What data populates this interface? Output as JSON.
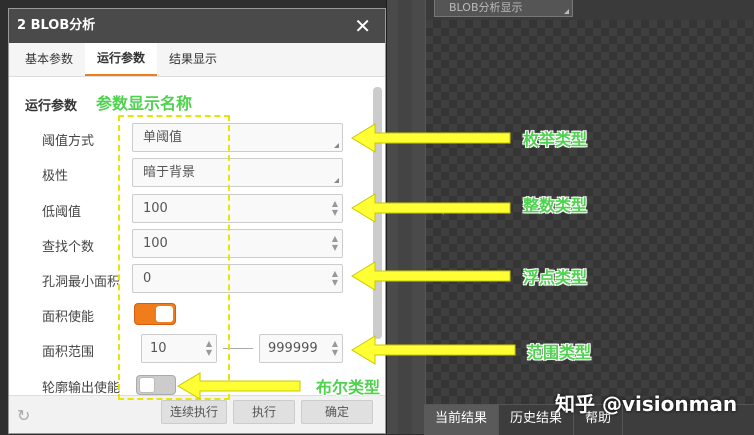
{
  "dialog": {
    "title": "2 BLOB分析",
    "close": "✕",
    "tabs": [
      "基本参数",
      "运行参数",
      "结果显示"
    ],
    "section_title": "运行参数",
    "params": {
      "threshold_mode": {
        "label": "阈值方式",
        "value": "单阈值"
      },
      "polarity": {
        "label": "极性",
        "value": "暗于背景"
      },
      "low_threshold": {
        "label": "低阈值",
        "value": "100"
      },
      "find_count": {
        "label": "查找个数",
        "value": "100"
      },
      "min_hole_area": {
        "label": "孔洞最小面积",
        "value": "0"
      },
      "area_enable": {
        "label": "面积使能",
        "value": "on"
      },
      "area_range": {
        "label": "面积范围",
        "min": "10",
        "max": "999999"
      },
      "contour_output": {
        "label": "轮廓输出使能",
        "value": "off"
      }
    },
    "buttons": {
      "run_continuous": "连续执行",
      "run": "执行",
      "ok": "确定"
    }
  },
  "right_panel": {
    "top_combo": "BLOB分析显示",
    "bottom_tabs": [
      "当前结果",
      "历史结果",
      "帮助"
    ]
  },
  "annotations": {
    "param_name": "参数显示名称",
    "enum_type": "枚举类型",
    "int_type": "整数类型",
    "float_type": "浮点类型",
    "range_type": "范围类型",
    "bool_type": "布尔类型"
  },
  "watermark": "知乎 @visionman",
  "colors": {
    "accent": "#f07c1b",
    "annotation_text": "#4fd24f",
    "arrow_fill": "#ffff33",
    "highlight_box": "#e6e600"
  }
}
